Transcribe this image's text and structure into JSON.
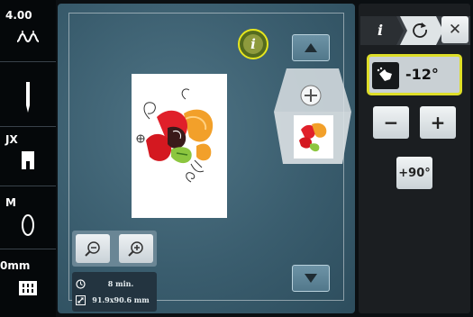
{
  "status_bar": {
    "thread_tension": "4.00",
    "presser_foot": "JX",
    "bobbin": "M",
    "stitch_width": "0mm"
  },
  "workspace": {
    "info_label": "i",
    "stats": {
      "time": "8 min.",
      "size": "91.9x90.6 mm"
    }
  },
  "right_panel": {
    "info_tab_label": "i",
    "close_label": "✕",
    "rotation_value": "-12°",
    "minus_label": "−",
    "plus_label": "+",
    "plus90_label": "+90°"
  },
  "icons": [
    "tension-icon",
    "needle-icon",
    "presser-foot-icon",
    "bobbin-icon",
    "feed-dog-icon",
    "zoom-out-icon",
    "zoom-in-icon",
    "clock-icon",
    "resize-icon",
    "up-arrow-icon",
    "down-arrow-icon",
    "rotate-icon",
    "hand-rotate-icon",
    "close-icon"
  ],
  "colors": {
    "accent_yellow": "#dede28",
    "canvas_blue": "#3a5d6e",
    "panel_dark": "#1b1e21"
  }
}
